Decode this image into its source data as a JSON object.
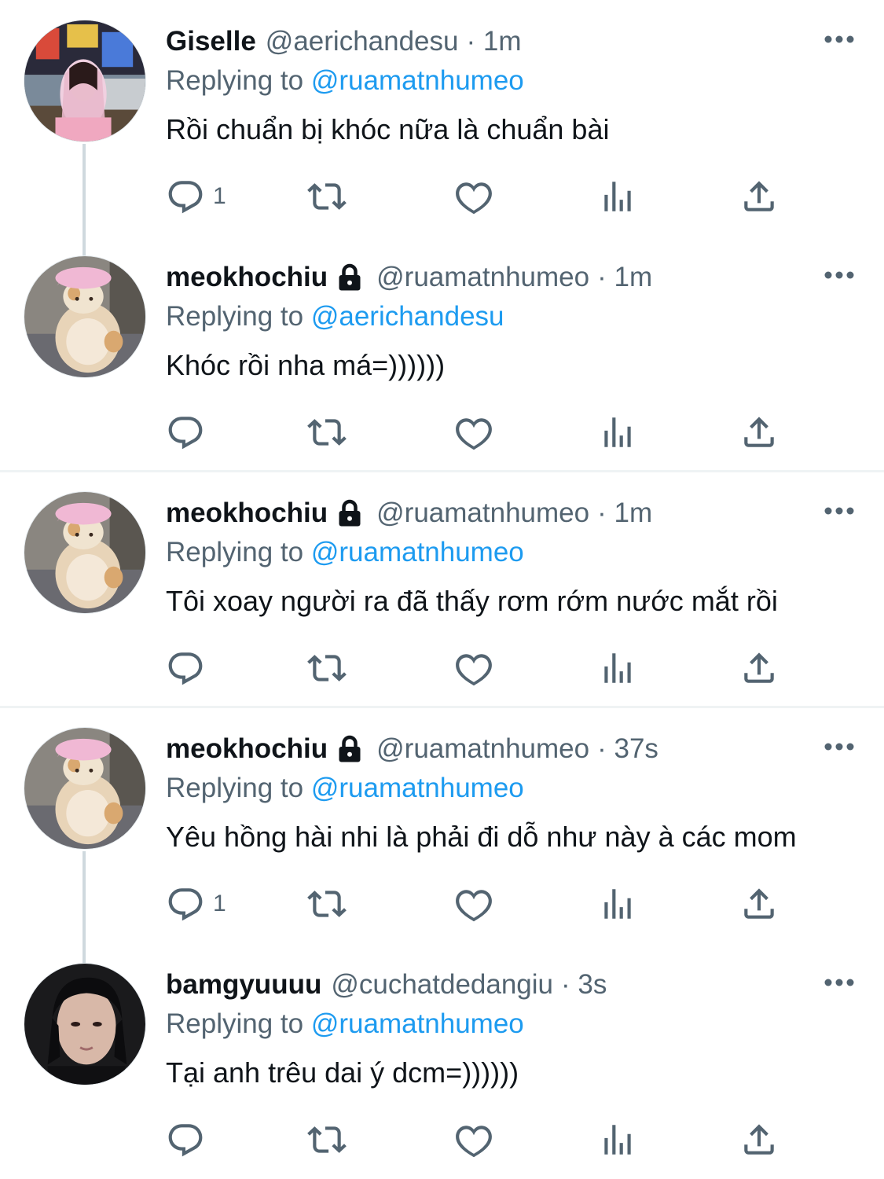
{
  "reply_prefix": "Replying to ",
  "tweets": [
    {
      "name": "Giselle",
      "locked": false,
      "handle": "@aerichandesu",
      "time": "· 1m",
      "reply_to": "@ruamatnhumeo",
      "text": "Rồi chuẩn bị khóc nữa là chuẩn bài",
      "reply_count": "1",
      "avatar": "girl-pink-hoodie"
    },
    {
      "name": "meokhochiu",
      "locked": true,
      "handle": "@ruamatnhumeo",
      "time": "· 1m",
      "reply_to": "@aerichandesu",
      "text": "Khóc rồi nha má=))))))",
      "reply_count": "",
      "avatar": "cat-pink-bonnet"
    },
    {
      "name": "meokhochiu",
      "locked": true,
      "handle": "@ruamatnhumeo",
      "time": "· 1m",
      "reply_to": "@ruamatnhumeo",
      "text": "Tôi xoay người ra đã thấy rơm rớm nước mắt rồi",
      "reply_count": "",
      "avatar": "cat-pink-bonnet"
    },
    {
      "name": "meokhochiu",
      "locked": true,
      "handle": "@ruamatnhumeo",
      "time": "· 37s",
      "reply_to": "@ruamatnhumeo",
      "text": "Yêu hồng hài nhi là phải đi dỗ như này à các mom",
      "reply_count": "1",
      "avatar": "cat-pink-bonnet"
    },
    {
      "name": "bamgyuuuu",
      "locked": false,
      "handle": "@cuchatdedangiu",
      "time": "· 3s",
      "reply_to": "@ruamatnhumeo",
      "text": "Tại anh trêu dai ý dcm=))))))",
      "reply_count": "",
      "avatar": "boy-dark-portrait"
    }
  ],
  "colors": {
    "link": "#1d9bf0",
    "secondary_text": "#536471",
    "thread_line": "#cfd9de",
    "divider": "#eff3f4"
  },
  "icons": [
    "more-icon",
    "reply-icon",
    "retweet-icon",
    "like-icon",
    "views-icon",
    "share-icon",
    "lock-icon"
  ]
}
